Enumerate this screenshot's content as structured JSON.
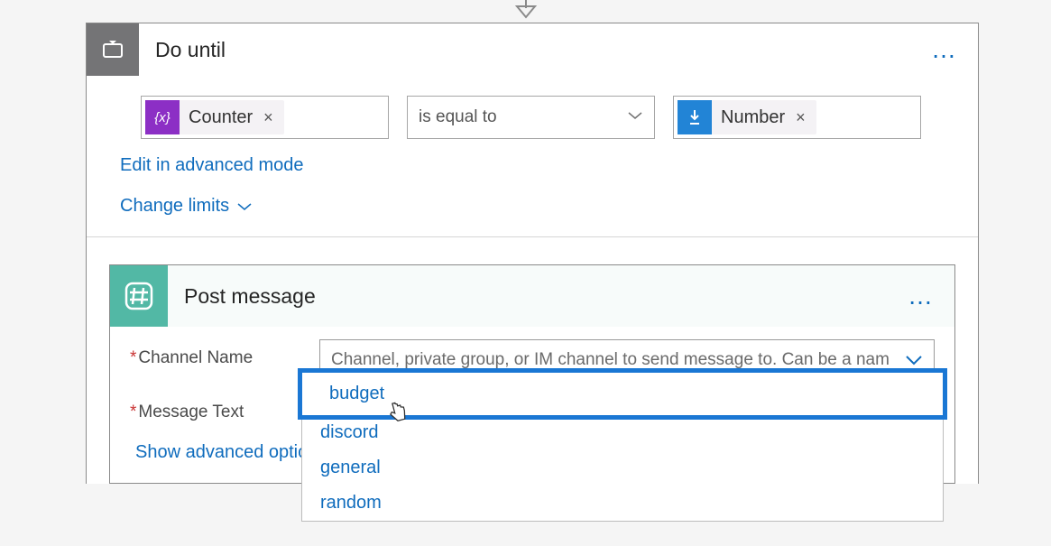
{
  "arrow": "connector-arrow",
  "doUntil": {
    "title": "Do until",
    "more": "…",
    "condition": {
      "leftToken": {
        "icon": "{x}",
        "label": "Counter"
      },
      "operator": "is equal to",
      "rightToken": {
        "icon": "touch",
        "label": "Number"
      }
    },
    "links": {
      "advancedMode": "Edit in advanced mode",
      "changeLimits": "Change limits"
    }
  },
  "postMessage": {
    "title": "Post message",
    "more": "…",
    "fields": {
      "channelName": {
        "label": "Channel Name",
        "placeholder": "Channel, private group, or IM channel to send message to. Can be a nam"
      },
      "messageText": {
        "label": "Message Text"
      }
    },
    "dropdown": {
      "options": [
        "budget",
        "discord",
        "general",
        "random"
      ],
      "highlighted": "budget"
    },
    "advancedOptions": "Show advanced options"
  }
}
